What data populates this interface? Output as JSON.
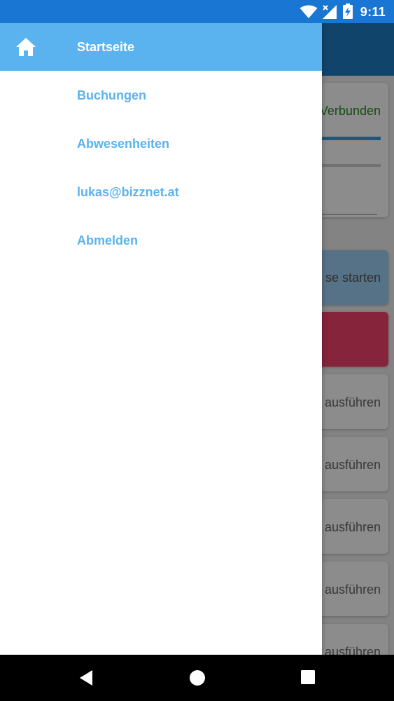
{
  "status_bar": {
    "time": "9:11",
    "icons": [
      "wifi-icon",
      "signal-icon",
      "battery-charging-icon"
    ],
    "color": "#1976d2"
  },
  "background_app": {
    "connection_status": "Verbunden",
    "start_button_label": "se starten",
    "action_labels": [
      "ausführen",
      "ausführen",
      "ausführen",
      "ausführen",
      "ausführen"
    ],
    "toolbar_color": "#1f7cc4",
    "accent_red": "#f4436e"
  },
  "drawer": {
    "header": {
      "icon": "home-icon",
      "label": "Startseite",
      "color": "#5ab3ef"
    },
    "items": [
      {
        "label": "Buchungen"
      },
      {
        "label": "Abwesenheiten"
      },
      {
        "label": "lukas@bizznet.at"
      },
      {
        "label": "Abmelden"
      }
    ]
  },
  "nav_bar": {
    "icons": [
      "back-icon",
      "home-circle-icon",
      "recents-icon"
    ]
  }
}
